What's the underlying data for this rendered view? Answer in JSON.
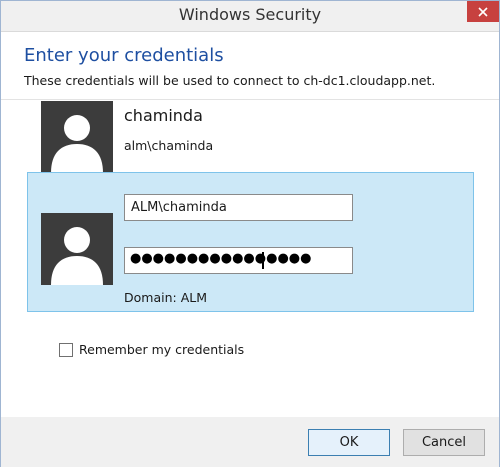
{
  "window": {
    "title": "Windows Security",
    "close_icon": "close-icon"
  },
  "header": {
    "heading": "Enter your credentials",
    "subheading": "These credentials will be used to connect to ch-dc1.cloudapp.net."
  },
  "saved_user": {
    "avatar_icon": "user-avatar-icon",
    "name": "chaminda",
    "account": "alm\\chaminda"
  },
  "selected_user": {
    "avatar_icon": "user-avatar-icon",
    "username_value": "ALM\\chaminda",
    "password_mask": "●●●●●●●●●●●●●●●●",
    "domain": "Domain: ALM"
  },
  "remember": {
    "label": "Remember my credentials",
    "checked": false
  },
  "buttons": {
    "ok": "OK",
    "cancel": "Cancel"
  },
  "colors": {
    "accent_heading": "#1e4fa1",
    "close_button": "#c7413f",
    "selected_tile": "#cce8f7",
    "selected_border": "#7ec3ea"
  }
}
